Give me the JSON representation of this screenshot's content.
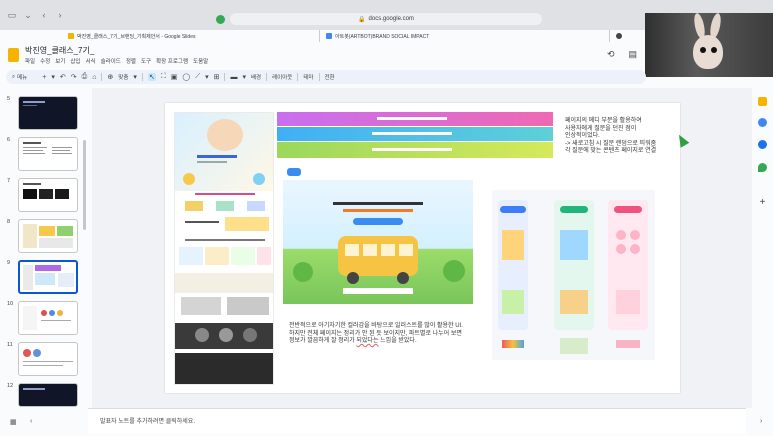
{
  "browser": {
    "url": "docs.google.com",
    "tabs": [
      {
        "label": "박진영_클래스_7기_브랜딩_기획제안서 - Google Slides",
        "active": true,
        "color": "#f4b400"
      },
      {
        "label": "아트봇(ARTBOT)BRAND SOCIAL IMPACT",
        "active": false,
        "color": "#4285f4"
      },
      {
        "label": "",
        "active": false,
        "color": "#444444"
      }
    ]
  },
  "app": {
    "title": "박진영_클래스_7기_",
    "menu": [
      "파일",
      "수정",
      "보기",
      "삽입",
      "서식",
      "슬라이드",
      "정렬",
      "도구",
      "확장 프로그램",
      "도움말"
    ]
  },
  "toolbar": {
    "search_label": "메뉴",
    "zoom_label": "맞춤",
    "background_label": "배경",
    "layout_label": "레이아웃",
    "theme_label": "테마",
    "transition_label": "전환"
  },
  "filmstrip": {
    "slides": [
      {
        "number": "5",
        "dark": true
      },
      {
        "number": "6",
        "dark": false
      },
      {
        "number": "7",
        "dark": false
      },
      {
        "number": "8",
        "dark": false
      },
      {
        "number": "9",
        "dark": false,
        "selected": true
      },
      {
        "number": "10",
        "dark": false
      },
      {
        "number": "11",
        "dark": false
      },
      {
        "number": "12",
        "dark": true
      }
    ]
  },
  "slide": {
    "note_top": [
      "페이지의 메디 부분을 활용하여",
      "사용자에게 질문을 던진 점이",
      "인상적이었다.",
      "-> 새로고침 시 질문 랜덤으로 띄워줌",
      "각 질문에 맞는 콘텐츠 페이지로 연결"
    ],
    "note_bottom_a": "전반적으로 아기자기한 컬러감을 바탕으로 일러스트를 많이 활용한 UI.",
    "note_bottom_b": "하지만 전체 페이지는 정리가 안 된 듯 보이지만, 파트별로 나누어 보면",
    "note_bottom_c": "정보가 깔끔하게 잘 정리가 ",
    "note_bottom_underlined": "되었다는",
    "note_bottom_d": " 느낌을 받았다.",
    "screenshot_right": {
      "eyebrow": "소중한 우리아이 두뇌, 표현력이 자라는 학습 프로그램",
      "title_a": "5~6세 아이를 위한",
      "title_b": "모든 콘텐츠를 담은 윌크아이",
      "columns": [
        {
          "label": "사고력 강화",
          "color": "#3f7cf6"
        },
        {
          "label": "문해력",
          "color": "#21b47b"
        },
        {
          "label": "창의 AI교육",
          "color": "#f0527e"
        }
      ]
    },
    "screenshot_main": {
      "nav": [
        "윌크아이 소개",
        "윌크아이커리큘럼",
        "자료마당",
        "체험",
        "참여 사교원",
        "고객센터",
        "AI Game"
      ],
      "headline_a": "우리 아이가 처음 시작하는 공부라서",
      "headline_b": "윌크아이",
      "headline_c": "입니다."
    }
  },
  "speaker_notes": {
    "placeholder": "발표자 노트를 추가하려면 클릭하세요."
  }
}
